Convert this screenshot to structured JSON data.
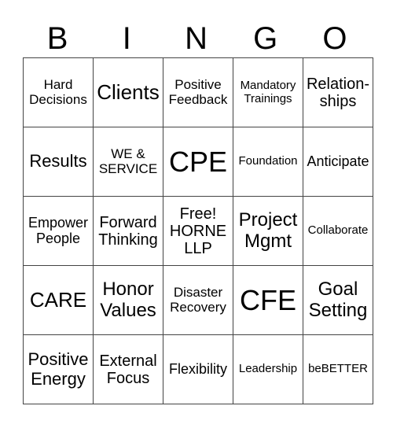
{
  "header": [
    "B",
    "I",
    "N",
    "G",
    "O"
  ],
  "rows": [
    [
      "Hard Decisions",
      "Clients",
      "Positive Feedback",
      "Mandatory Trainings",
      "Relation-ships"
    ],
    [
      "Results",
      "WE & SERVICE",
      "CPE",
      "Foundation",
      "Anticipate"
    ],
    [
      "Empower People",
      "Forward Thinking",
      "Free! HORNE LLP",
      "Project Mgmt",
      "Collaborate"
    ],
    [
      "CARE",
      "Honor Values",
      "Disaster Recovery",
      "CFE",
      "Goal Setting"
    ],
    [
      "Positive Energy",
      "External Focus",
      "Flexibility",
      "Leadership",
      "beBETTER"
    ]
  ]
}
